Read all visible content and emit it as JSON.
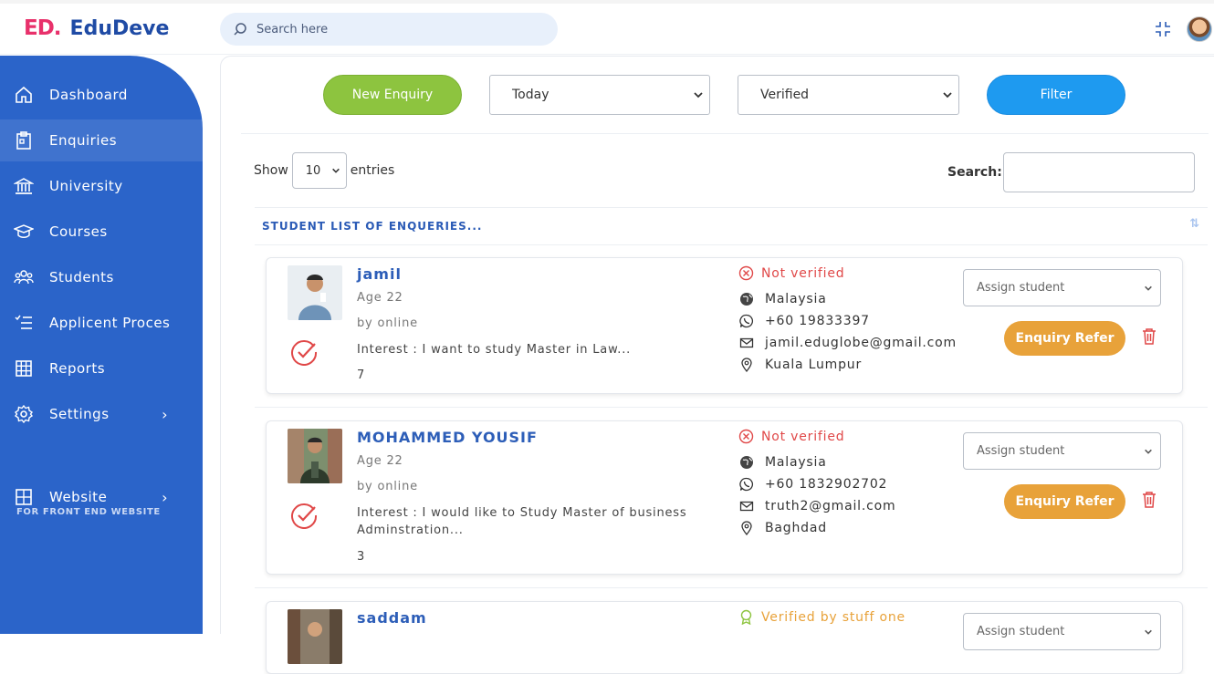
{
  "brand": {
    "mark": "ED.",
    "name": "EduDeve"
  },
  "topbar": {
    "search_placeholder": "Search here"
  },
  "sidebar": {
    "items": [
      {
        "label": "Dashboard",
        "icon": "home-icon"
      },
      {
        "label": "Enquiries",
        "icon": "clipboard-icon"
      },
      {
        "label": "University",
        "icon": "bank-icon"
      },
      {
        "label": "Courses",
        "icon": "graduation-cap-icon"
      },
      {
        "label": "Students",
        "icon": "users-icon"
      },
      {
        "label": "Applicent Proces",
        "icon": "checklist-icon"
      },
      {
        "label": "Reports",
        "icon": "grid-icon"
      },
      {
        "label": "Settings",
        "icon": "gear-icon"
      },
      {
        "label": "Website",
        "icon": "layout-icon"
      }
    ],
    "section_label": "FOR FRONT END WEBSITE",
    "active": "Enquiries"
  },
  "toolbar": {
    "new_enquiry": "New Enquiry",
    "date_filter": "Today",
    "status_filter": "Verified",
    "filter_button": "Filter"
  },
  "table_controls": {
    "show_label": "Show",
    "page_size": "10",
    "entries_label": "entries",
    "search_label": "Search:"
  },
  "table": {
    "header": "STUDENT LIST OF ENQUERIES..."
  },
  "enquiries": [
    {
      "name": "jamil",
      "age": "Age 22",
      "source": "by online",
      "interest": "Interest : I want to study Master in Law...",
      "count": "7",
      "status": "Not verified",
      "country": "Malaysia",
      "phone": "+60 19833397",
      "email": "jamil.eduglobe@gmail.com",
      "city": "Kuala Lumpur",
      "assign_placeholder": "Assign student",
      "refer_label": "Enquiry Refer"
    },
    {
      "name": "MOHAMMED YOUSIF",
      "age": "Age 22",
      "source": "by online",
      "interest": "Interest : I would like to Study Master of business Adminstration...",
      "count": "3",
      "status": "Not verified",
      "country": "Malaysia",
      "phone": "+60 1832902702",
      "email": "truth2@gmail.com",
      "city": "Baghdad",
      "assign_placeholder": "Assign student",
      "refer_label": "Enquiry Refer"
    },
    {
      "name": "saddam",
      "status": "Verified by stuff one",
      "assign_placeholder": "Assign student"
    }
  ],
  "colors": {
    "sidebar": "#2b64c9",
    "brand_blue": "#1f4ba5",
    "brand_pink": "#e8316b",
    "green_button": "#8dc43f",
    "blue_button": "#1e9af0",
    "refer_button": "#e8a23a",
    "not_verified": "#e04848",
    "verified": "#e8a23a"
  }
}
